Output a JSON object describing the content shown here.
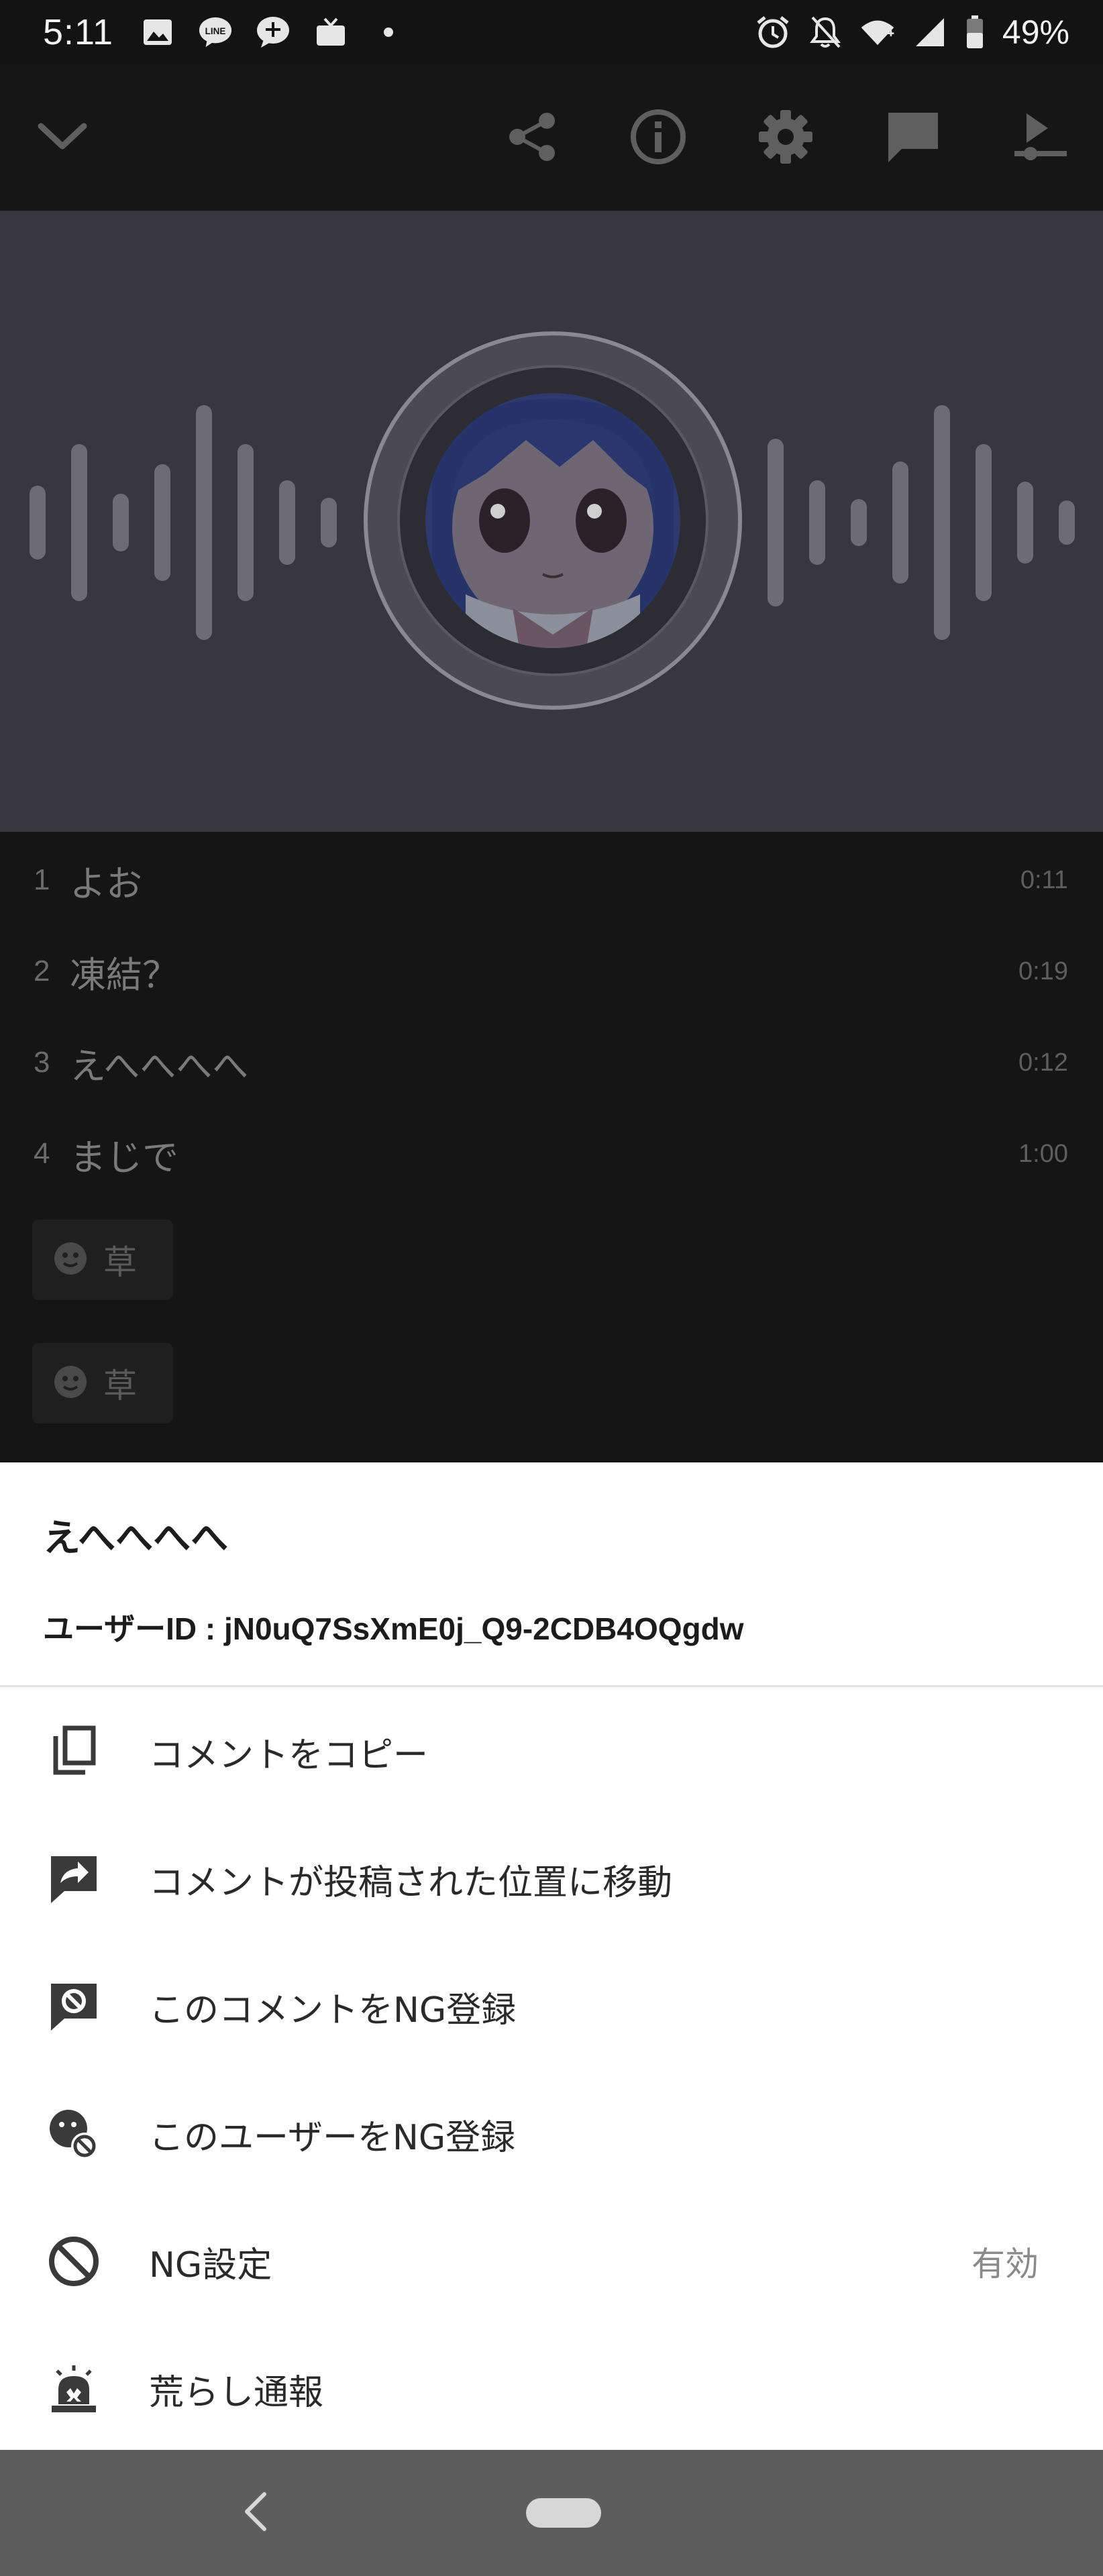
{
  "status_bar": {
    "time": "5:11",
    "battery": "49%",
    "left_icons": [
      "image-icon",
      "line-icon",
      "chat-plus-icon",
      "tv-icon",
      "dot-icon"
    ],
    "right_icons": [
      "alarm-icon",
      "notifications-off-icon",
      "wifi-icon",
      "signal-icon",
      "battery-icon"
    ]
  },
  "app_bar": {
    "icons": [
      "chevron-down-icon",
      "share-icon",
      "info-icon",
      "settings-icon",
      "comment-icon",
      "playlist-play-icon"
    ]
  },
  "tracks": [
    {
      "num": "1",
      "title": "よお",
      "duration": "0:11"
    },
    {
      "num": "2",
      "title": "凍結？",
      "duration": "0:19"
    },
    {
      "num": "3",
      "title": "えへへへへ",
      "duration": "0:12"
    },
    {
      "num": "4",
      "title": "まじで",
      "duration": "1:00"
    }
  ],
  "comment_chips": [
    {
      "label": "草"
    },
    {
      "label": "草"
    }
  ],
  "sheet": {
    "title": "えへへへへ",
    "user_id": "ユーザーID : jN0uQ7SsXmE0j_Q9-2CDB4OQgdw",
    "items": [
      {
        "label": "コメントをコピー",
        "icon": "copy-icon"
      },
      {
        "label": "コメントが投稿された位置に移動",
        "icon": "jump-to-position-icon"
      },
      {
        "label": "このコメントをNG登録",
        "icon": "block-comment-icon"
      },
      {
        "label": "このユーザーをNG登録",
        "icon": "block-user-icon"
      },
      {
        "label": "NG設定",
        "icon": "block-icon",
        "value": "有効"
      },
      {
        "label": "荒らし通報",
        "icon": "report-alarm-icon"
      }
    ]
  },
  "colors": {
    "background": "#131313",
    "player_bg": "#38373e",
    "sheet_bg": "#ffffff",
    "nav_bar": "#5d5d5d"
  }
}
